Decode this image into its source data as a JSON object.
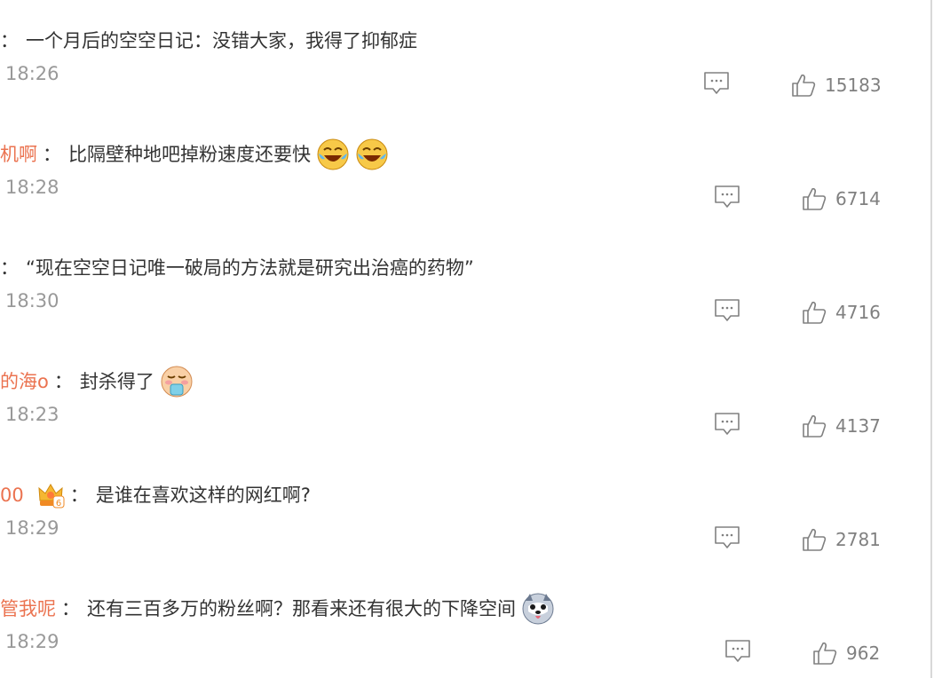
{
  "comments": [
    {
      "username": "",
      "colon": "：",
      "text": "一个月后的空空日记：没错大家，我得了抑郁症",
      "time": "18:26",
      "likes": "15183"
    },
    {
      "username": "机啊",
      "colon": "：",
      "text": "比隔壁种地吧掉粉速度还要快",
      "time": "18:28",
      "likes": "6714",
      "emojis": [
        "laugh-cry-emoji",
        "laugh-cry-emoji"
      ]
    },
    {
      "username": "",
      "colon": "：",
      "text": "“现在空空日记唯一破局的方法就是研究出治癌的药物”",
      "time": "18:30",
      "likes": "4716"
    },
    {
      "username": "的海o",
      "colon": "：",
      "text": "封杀得了",
      "time": "18:23",
      "likes": "4137",
      "emojis": [
        "vomit-emoji"
      ]
    },
    {
      "username": "00",
      "colon": "：",
      "text": "是谁在喜欢这样的网红啊?",
      "time": "18:29",
      "likes": "2781",
      "badge": "6"
    },
    {
      "username": "管我呢",
      "colon": "：",
      "text": "还有三百多万的粉丝啊？那看来还有很大的下降空间",
      "time": "18:29",
      "likes": "962",
      "emojis": [
        "husky-dog-emoji"
      ]
    }
  ]
}
